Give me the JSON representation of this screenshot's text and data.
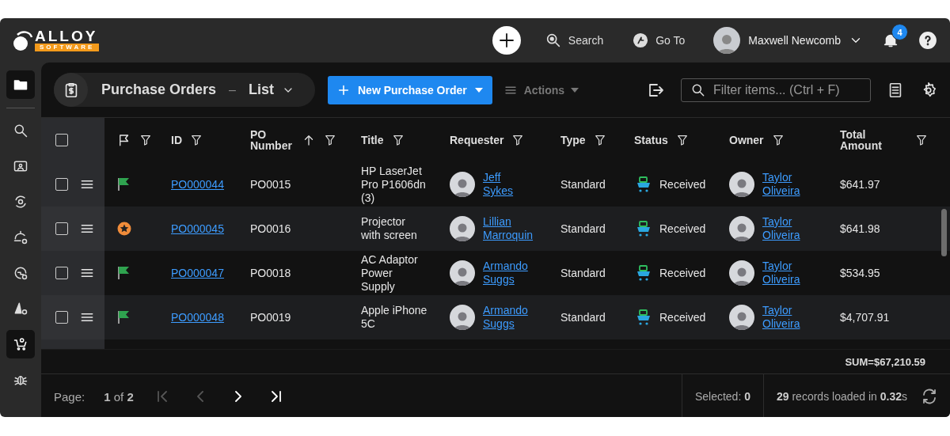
{
  "logo": {
    "word": "ALLOY",
    "sub": "SOFTWARE"
  },
  "top_nav": {
    "search": "Search",
    "goto": "Go To",
    "user": "Maxwell Newcomb",
    "notifications": "4"
  },
  "sidebar": {
    "top": {
      "selected": true
    },
    "items": [
      {
        "selected": false
      },
      {
        "selected": false
      },
      {
        "selected": false
      },
      {
        "selected": false
      },
      {
        "selected": false
      },
      {
        "selected": false
      },
      {
        "selected": true
      },
      {
        "selected": false
      }
    ]
  },
  "toolbar": {
    "title": "Purchase Orders",
    "separator": "–",
    "view": "List",
    "new_button": "New Purchase Order",
    "actions": {
      "label": "Actions",
      "disabled": true
    },
    "filter": {
      "placeholder": "Filter items... (Ctrl + F)"
    }
  },
  "table": {
    "all_selected": false,
    "columns": [
      {
        "label": "ID",
        "sorted": false
      },
      {
        "label": "PO Number",
        "sorted": true
      },
      {
        "label": "Title",
        "sorted": false
      },
      {
        "label": "Requester",
        "sorted": false
      },
      {
        "label": "Type",
        "sorted": false
      },
      {
        "label": "Status",
        "sorted": false
      },
      {
        "label": "Owner",
        "sorted": false
      },
      {
        "label": "Total Amount",
        "sorted": false
      }
    ],
    "rows": [
      {
        "selected": false,
        "kind": "flag",
        "id": "PO000044",
        "po_number": "PO0015",
        "title": "HP LaserJet Pro P1606dn (3)",
        "requester": "Jeff Sykes",
        "type": "Standard",
        "status": "Received",
        "owner": "Taylor Oliveira",
        "total": "$641.97"
      },
      {
        "selected": false,
        "kind": "star",
        "id": "PO000045",
        "po_number": "PO0016",
        "title": "Projector with screen",
        "requester": "Lillian Marroquin",
        "type": "Standard",
        "status": "Received",
        "owner": "Taylor Oliveira",
        "total": "$641.98"
      },
      {
        "selected": false,
        "kind": "flag",
        "id": "PO000047",
        "po_number": "PO0018",
        "title": "AC Adaptor Power Supply",
        "requester": "Armando Suggs",
        "type": "Standard",
        "status": "Received",
        "owner": "Taylor Oliveira",
        "total": "$534.95"
      },
      {
        "selected": false,
        "kind": "flag",
        "id": "PO000048",
        "po_number": "PO0019",
        "title": "Apple iPhone 5C",
        "requester": "Armando Suggs",
        "type": "Standard",
        "status": "Received",
        "owner": "Taylor Oliveira",
        "total": "$4,707.91"
      }
    ],
    "sum": "SUM=$67,210.59"
  },
  "footer": {
    "page_label": "Page:",
    "page": "**1** of **2**",
    "pager": [
      {
        "kind": "first",
        "disabled": true
      },
      {
        "kind": "prev",
        "disabled": true
      },
      {
        "kind": "next",
        "disabled": false
      },
      {
        "kind": "last",
        "disabled": false
      }
    ],
    "selected": "Selected: **0**",
    "records": "**29** records loaded in **0.32**s"
  }
}
